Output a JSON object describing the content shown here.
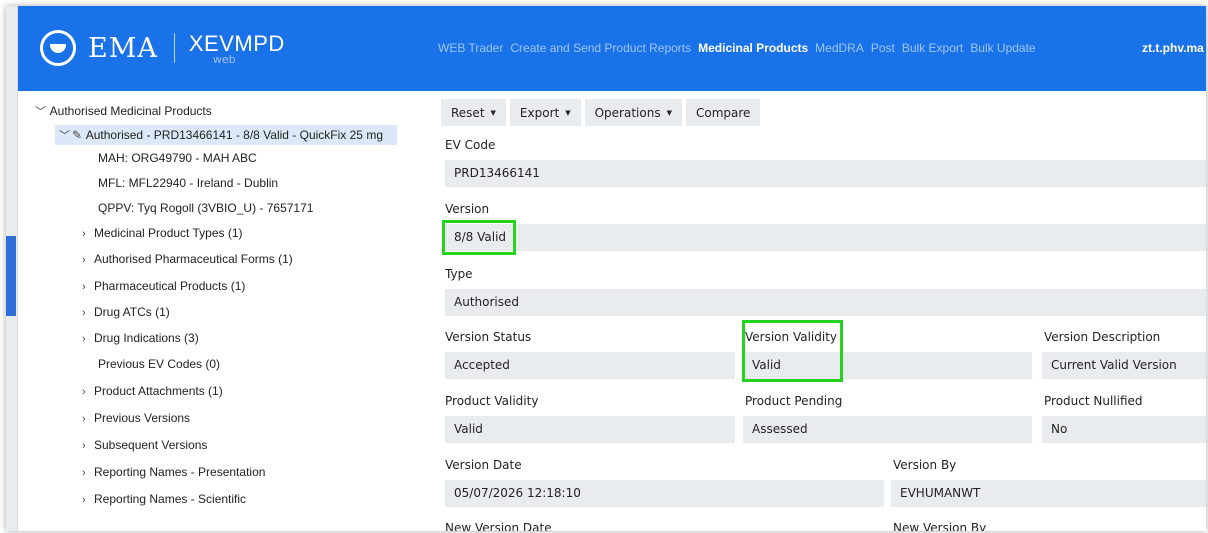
{
  "header": {
    "logo_text": "EMA",
    "product_name": "XEVMPD",
    "product_sub": "web",
    "nav": [
      "WEB Trader",
      "Create and Send Product Reports",
      "Medicinal Products",
      "MedDRA",
      "Post",
      "Bulk Export",
      "Bulk Update"
    ],
    "active_nav": "Medicinal Products",
    "user": "zt.t.phv.ma"
  },
  "tree": {
    "root": "Authorised Medicinal Products",
    "selected": "Authorised - PRD13466141 - 8/8 Valid - QuickFix 25 mg",
    "info": [
      "MAH: ORG49790 - MAH ABC",
      "MFL: MFL22940 - Ireland - Dublin",
      "QPPV: Tyq Rogoll (3VBIO_U) - 7657171"
    ],
    "children": [
      {
        "label": "Medicinal Product Types (1)",
        "expandable": true
      },
      {
        "label": "Authorised Pharmaceutical Forms (1)",
        "expandable": true
      },
      {
        "label": "Pharmaceutical Products (1)",
        "expandable": true
      },
      {
        "label": "Drug ATCs (1)",
        "expandable": true
      },
      {
        "label": "Drug Indications (3)",
        "expandable": true
      },
      {
        "label": "Previous EV Codes (0)",
        "expandable": false
      },
      {
        "label": "Product Attachments (1)",
        "expandable": true
      },
      {
        "label": "Previous Versions",
        "expandable": true
      },
      {
        "label": "Subsequent Versions",
        "expandable": true
      },
      {
        "label": "Reporting Names - Presentation",
        "expandable": true
      },
      {
        "label": "Reporting Names - Scientific",
        "expandable": true
      }
    ]
  },
  "toolbar": {
    "reset": "Reset",
    "export": "Export",
    "operations": "Operations",
    "compare": "Compare"
  },
  "fields": {
    "ev_code": {
      "label": "EV Code",
      "value": "PRD13466141"
    },
    "version": {
      "label": "Version",
      "value": "8/8 Valid"
    },
    "type": {
      "label": "Type",
      "value": "Authorised"
    },
    "version_status": {
      "label": "Version Status",
      "value": "Accepted"
    },
    "version_validity": {
      "label": "Version Validity",
      "value": "Valid"
    },
    "version_description": {
      "label": "Version Description",
      "value": "Current Valid Version"
    },
    "product_validity": {
      "label": "Product Validity",
      "value": "Valid"
    },
    "product_pending": {
      "label": "Product Pending",
      "value": "Assessed"
    },
    "product_nullified": {
      "label": "Product Nullified",
      "value": "No"
    },
    "version_date": {
      "label": "Version Date",
      "value": "05/07/2026 12:18:10"
    },
    "version_by": {
      "label": "Version By",
      "value": "EVHUMANWT"
    },
    "new_version_date": {
      "label": "New Version Date"
    },
    "new_version_by": {
      "label": "New Version By"
    }
  },
  "colors": {
    "header_blue": "#1a72e8",
    "highlight_green": "#25d31e",
    "field_bg": "#e9ecef"
  }
}
